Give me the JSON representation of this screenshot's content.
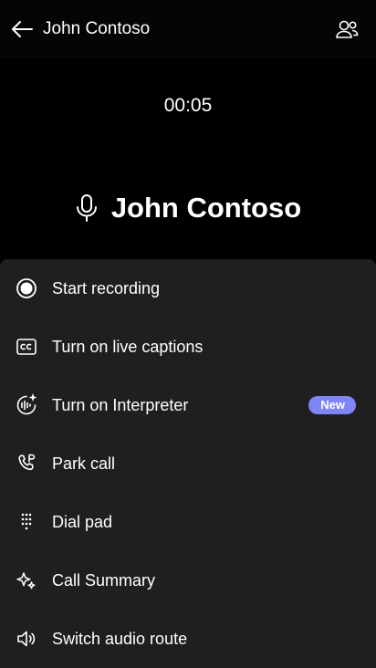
{
  "header": {
    "title": "John Contoso",
    "back_icon": "arrow-left-icon",
    "people_icon": "people-icon"
  },
  "call": {
    "timer": "00:05",
    "caller_name": "John Contoso",
    "mic_icon": "microphone-icon"
  },
  "menu": {
    "items": [
      {
        "label": "Start recording",
        "icon": "record-icon"
      },
      {
        "label": "Turn on live captions",
        "icon": "closed-captions-icon"
      },
      {
        "label": "Turn on Interpreter",
        "icon": "interpreter-icon",
        "badge": "New"
      },
      {
        "label": "Park call",
        "icon": "park-call-icon"
      },
      {
        "label": "Dial pad",
        "icon": "dialpad-icon"
      },
      {
        "label": "Call Summary",
        "icon": "sparkle-icon"
      },
      {
        "label": "Switch audio route",
        "icon": "speaker-icon"
      }
    ]
  },
  "colors": {
    "background": "#000000",
    "sheet": "#1f1f1f",
    "badge": "#7f85f5",
    "text": "#ffffff"
  }
}
